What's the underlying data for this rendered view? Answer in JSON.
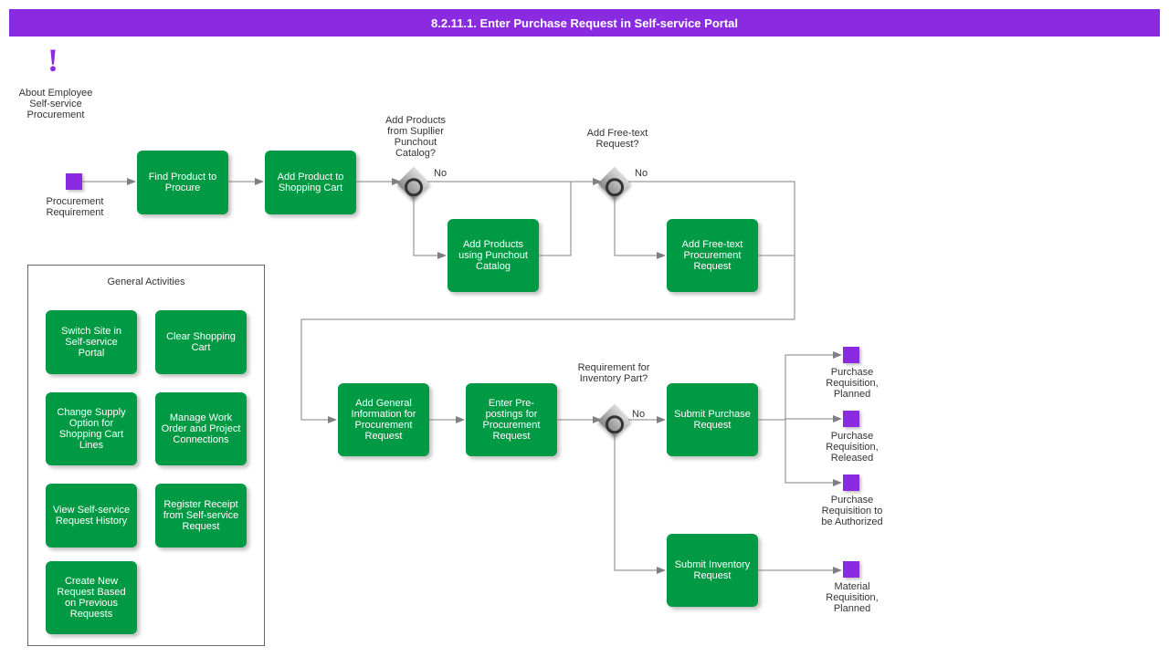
{
  "title": "8.2.11.1. Enter Purchase Request in Self-service Portal",
  "note": {
    "icon": "!",
    "label": "About Employee Self-service Procurement"
  },
  "start": {
    "label": "Procurement Requirement"
  },
  "activities": {
    "find_product": "Find Product to Procure",
    "add_cart": "Add Product to Shopping Cart",
    "add_punchout": "Add Products using Punchout Catalog",
    "add_freetext": "Add Free-text Procurement Request",
    "add_general": "Add General Information for Procurement Request",
    "enter_prepost": "Enter Pre-postings for Procurement Request",
    "submit_purchase": "Submit Purchase Request",
    "submit_inventory": "Submit Inventory Request"
  },
  "gateways": {
    "punchout": {
      "label": "Add Products from Supllier Punchout Catalog?",
      "no": "No"
    },
    "freetext": {
      "label": "Add Free-text Request?",
      "no": "No"
    },
    "inventory": {
      "label": "Requirement for Inventory Part?",
      "no": "No"
    }
  },
  "ends": {
    "planned": "Purchase Requisition, Planned",
    "released": "Purchase Requisition, Released",
    "authorized": "Purchase Requisition to be Authorized",
    "material": "Material Requisition, Planned"
  },
  "group": {
    "title": "General Activities",
    "items": {
      "switch_site": "Switch Site in Self-service Portal",
      "clear_cart": "Clear Shopping Cart",
      "change_supply": "Change Supply Option for Shopping Cart Lines",
      "manage_work": "Manage Work Order and Project Connections",
      "view_history": "View Self-service Request History",
      "register_receipt": "Register Receipt from Self-service Request",
      "create_new": "Create New Request Based on Previous Requests"
    }
  }
}
